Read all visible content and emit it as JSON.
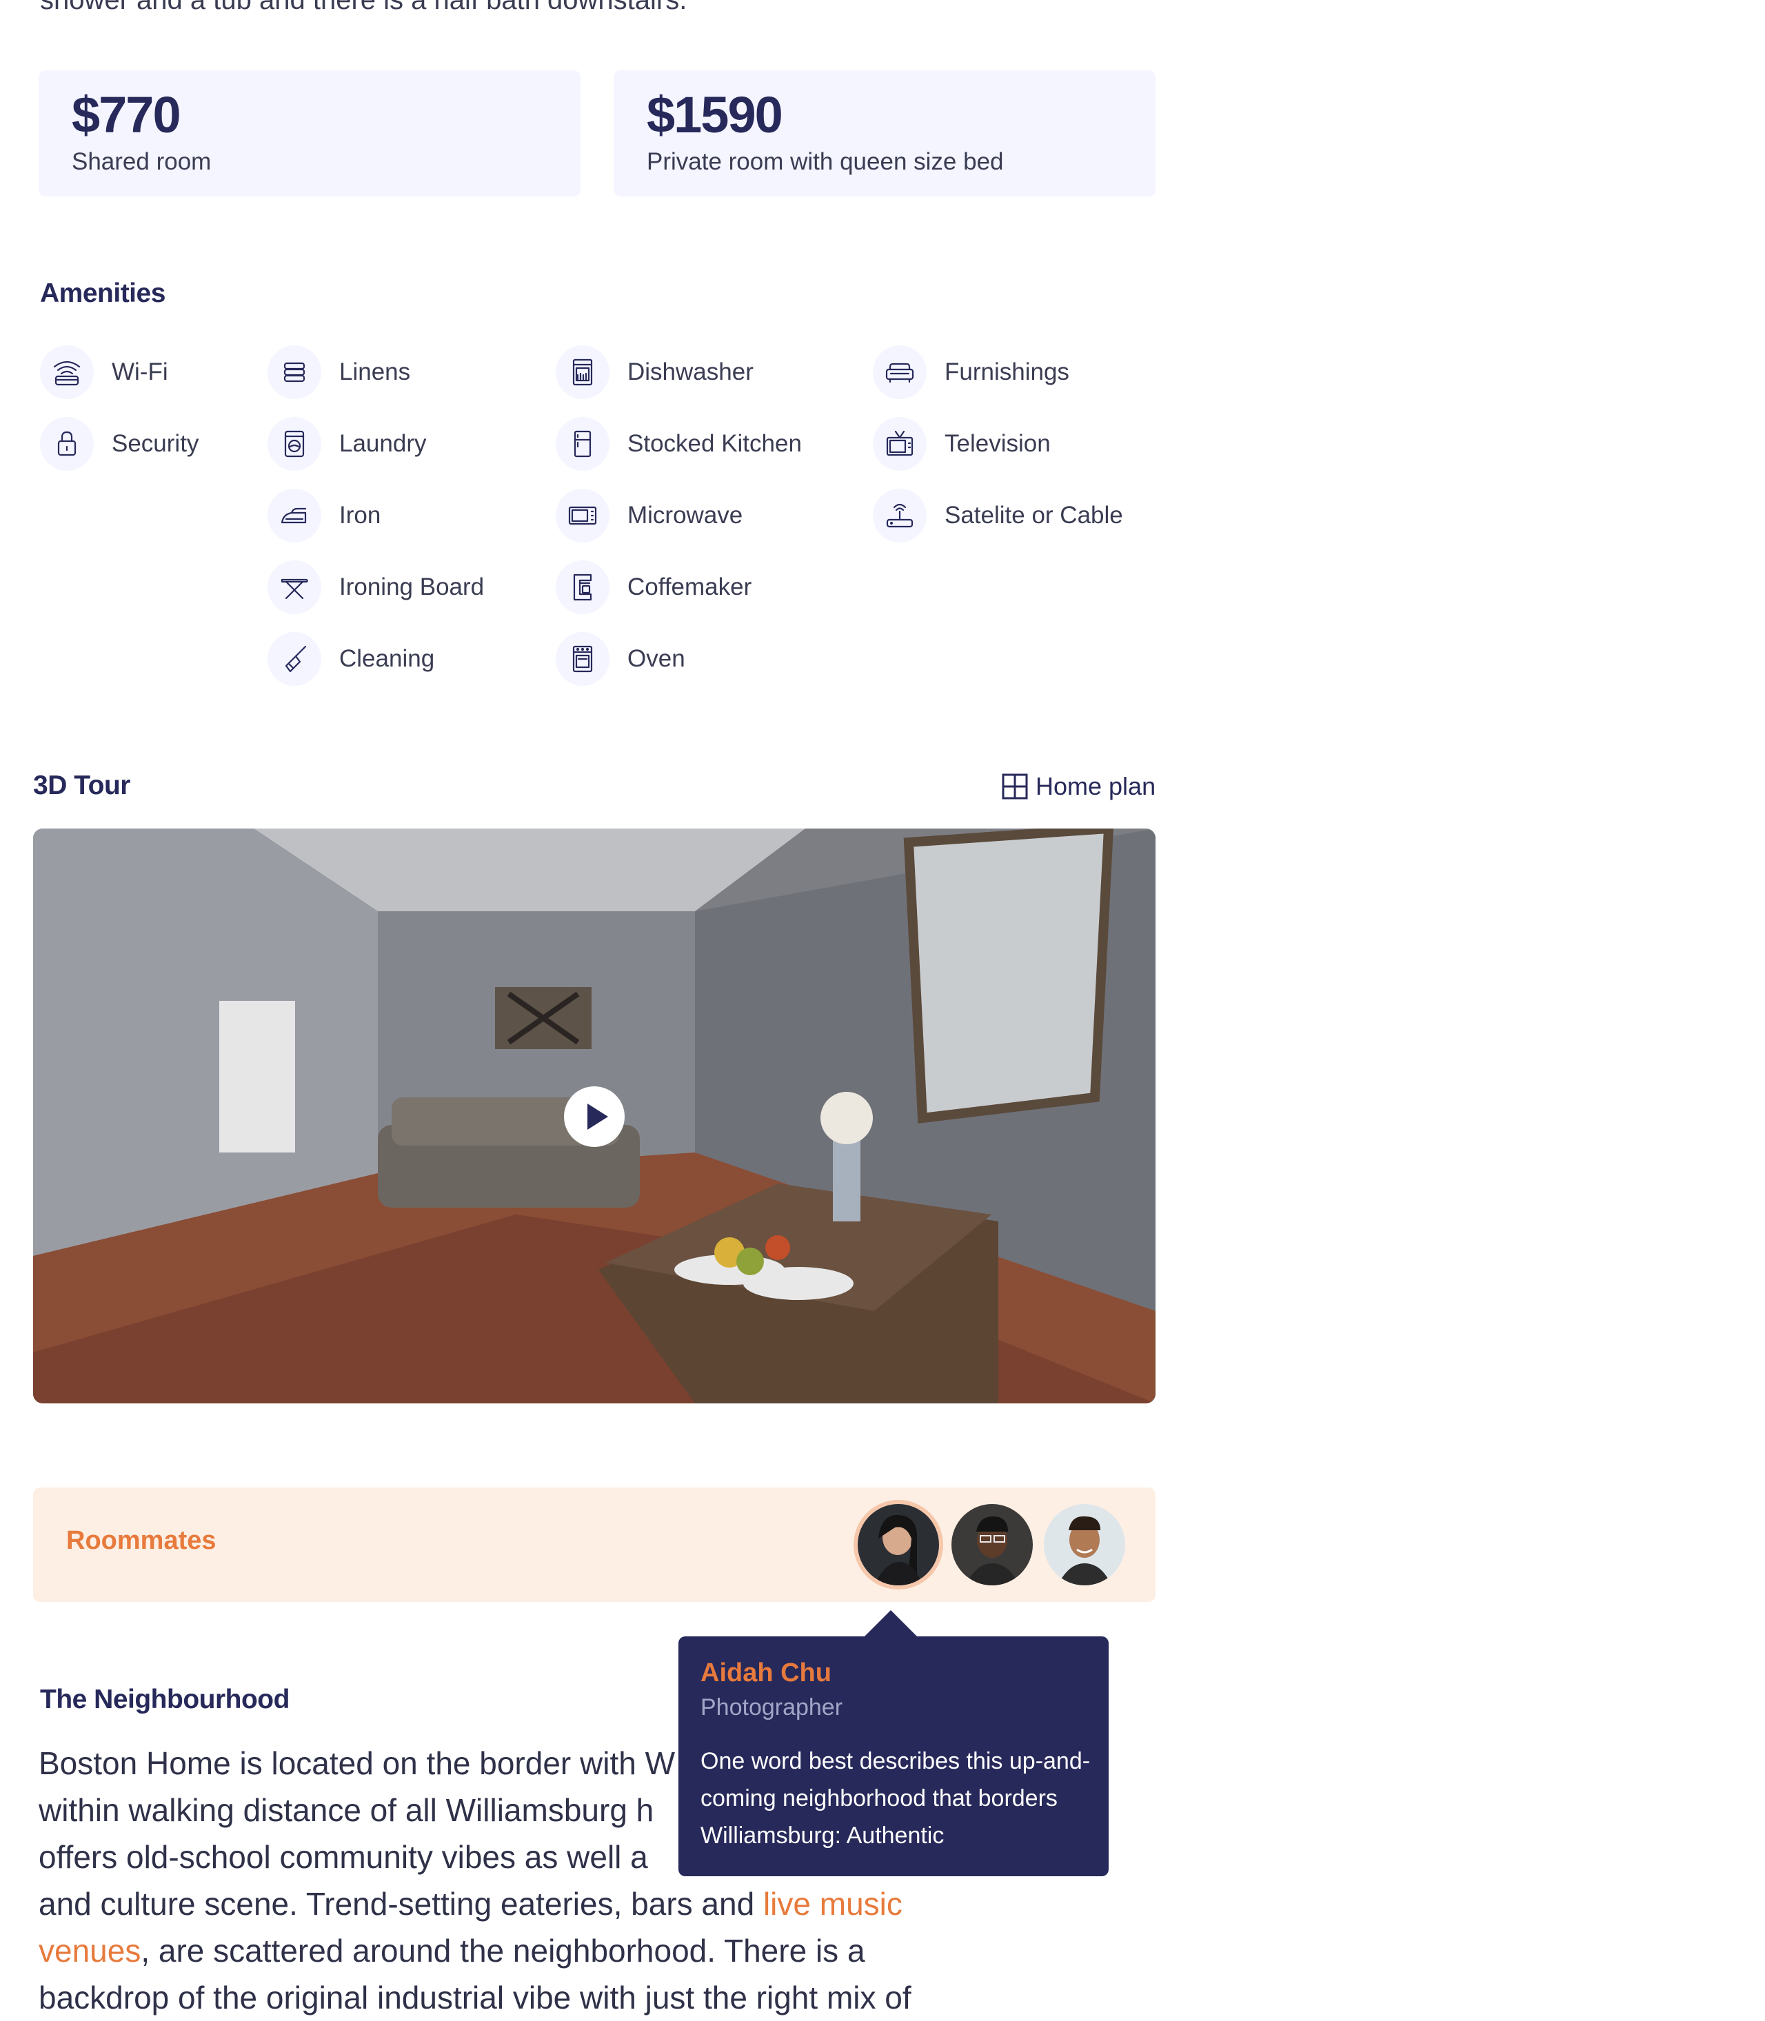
{
  "intro_tail": "shower and a tub and there is a half bath downstairs.",
  "prices": [
    {
      "amount": "$770",
      "desc": "Shared room"
    },
    {
      "amount": "$1590",
      "desc": "Private room with queen size bed"
    }
  ],
  "amenities": {
    "title": "Amenities",
    "col1": [
      {
        "label": "Wi-Fi",
        "icon": "wifi-icon"
      },
      {
        "label": "Security",
        "icon": "lock-icon"
      }
    ],
    "col2": [
      {
        "label": "Linens",
        "icon": "linens-icon"
      },
      {
        "label": "Laundry",
        "icon": "washing-machine-icon"
      },
      {
        "label": "Iron",
        "icon": "iron-icon"
      },
      {
        "label": "Ironing Board",
        "icon": "ironing-board-icon"
      },
      {
        "label": "Cleaning",
        "icon": "broom-icon"
      }
    ],
    "col3": [
      {
        "label": "Dishwasher",
        "icon": "dishwasher-icon"
      },
      {
        "label": "Stocked Kitchen",
        "icon": "fridge-icon"
      },
      {
        "label": "Microwave",
        "icon": "microwave-icon"
      },
      {
        "label": "Coffemaker",
        "icon": "coffeemaker-icon"
      },
      {
        "label": "Oven",
        "icon": "oven-icon"
      }
    ],
    "col4": [
      {
        "label": "Furnishings",
        "icon": "sofa-icon"
      },
      {
        "label": "Television",
        "icon": "tv-icon"
      },
      {
        "label": "Satelite or Cable",
        "icon": "router-icon"
      }
    ]
  },
  "tour": {
    "title": "3D Tour",
    "home_plan": "Home plan"
  },
  "roommates": {
    "title": "Roommates",
    "selected": {
      "name": "Aidah Chu",
      "role": "Photographer",
      "quote": "One word best describes this up-and-coming neighborhood that borders Williamsburg: Authentic"
    }
  },
  "neighbourhood": {
    "title": "The Neighbourhood",
    "line1": "Boston Home is located on the border with W",
    "line2": "within walking distance of all Williamsburg h",
    "line3": "offers old-school community vibes as well a",
    "line4a": "and culture scene. Trend-setting eateries, bars and ",
    "link": "live music venues",
    "line5b": ", are scattered around  the neighborhood. There is a",
    "line6": "backdrop of the original industrial vibe with just the right mix of"
  },
  "colors": {
    "navy": "#27295a",
    "accent": "#e77a3c",
    "card": "#f4f5ff",
    "peach": "#fdefe4"
  }
}
